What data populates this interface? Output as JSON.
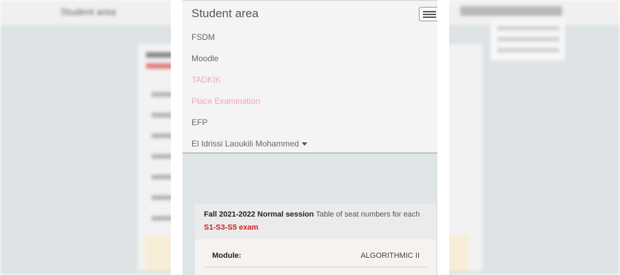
{
  "navbar": {
    "brand": "Student area",
    "items": [
      {
        "label": "FSDM",
        "color": "#666666"
      },
      {
        "label": "Moodle",
        "color": "#666666"
      },
      {
        "label": "TADKIK",
        "color": "#f2a7b0"
      },
      {
        "label": "Place Examination",
        "color": "#f2a7b0"
      },
      {
        "label": "EFP",
        "color": "#666666"
      }
    ],
    "user": "El Idrissi Laoukili Mohammed"
  },
  "panel": {
    "session": "Fall 2021-2022 Normal session",
    "description": "Table of seat numbers for each",
    "exam": "S1-S3-S5 exam",
    "module_label": "Module:",
    "module_value": "ALGORITHMIC II"
  },
  "icons": {
    "menu": "hamburger-menu-icon",
    "dropdown": "caret-down-icon"
  },
  "colors": {
    "exam_highlight": "#d21f1f",
    "disabled_link": "#f2a7b0"
  }
}
